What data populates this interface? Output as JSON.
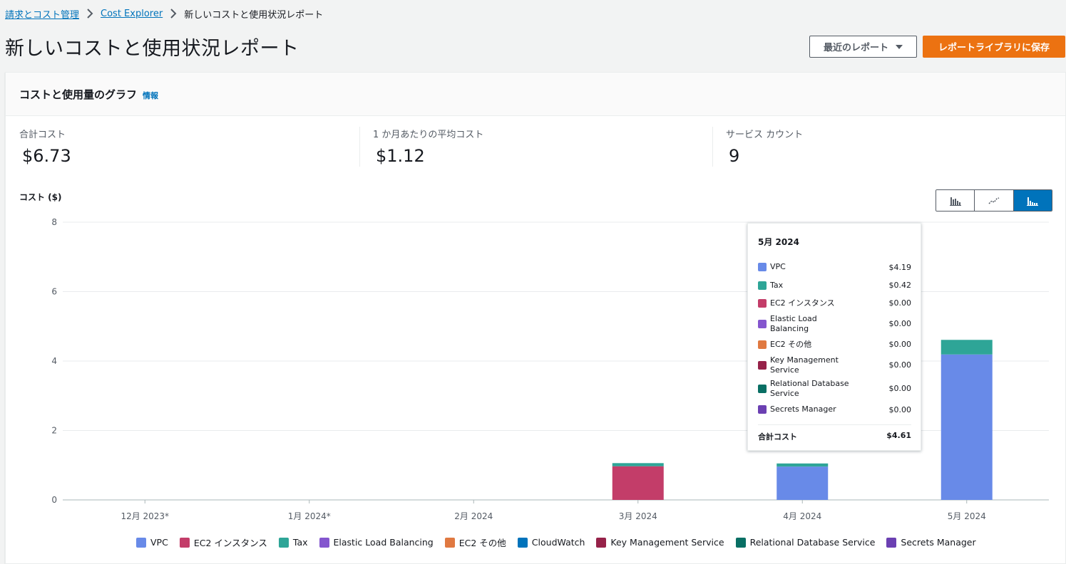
{
  "breadcrumb": {
    "items": [
      "請求とコスト管理",
      "Cost Explorer"
    ],
    "current": "新しいコストと使用状況レポート"
  },
  "header": {
    "title": "新しいコストと使用状況レポート",
    "recent_reports_label": "最近のレポート",
    "save_label": "レポートライブラリに保存"
  },
  "panel": {
    "title": "コストと使用量のグラフ",
    "info_label": "情報"
  },
  "metrics": [
    {
      "label": "合計コスト",
      "value": "$6.73"
    },
    {
      "label": "1 か月あたりの平均コスト",
      "value": "$1.12"
    },
    {
      "label": "サービス カウント",
      "value": "9"
    }
  ],
  "chart_controls": {
    "types": [
      "bar-grouped-icon",
      "line-icon",
      "bar-stacked-icon"
    ],
    "active": "bar-stacked-icon"
  },
  "tooltip": {
    "title": "5月 2024",
    "rows": [
      {
        "name": "VPC",
        "value": "$4.19",
        "color": "#688ae8"
      },
      {
        "name": "Tax",
        "value": "$0.42",
        "color": "#2ea597"
      },
      {
        "name": "EC2 インスタンス",
        "value": "$0.00",
        "color": "#c33d69"
      },
      {
        "name": "Elastic Load Balancing",
        "value": "$0.00",
        "color": "#8456ce"
      },
      {
        "name": "EC2 その他",
        "value": "$0.00",
        "color": "#e07941"
      },
      {
        "name": "Key Management Service",
        "value": "$0.00",
        "color": "#962249"
      },
      {
        "name": "Relational Database Service",
        "value": "$0.00",
        "color": "#096f64"
      },
      {
        "name": "Secrets Manager",
        "value": "$0.00",
        "color": "#6b40b2"
      }
    ],
    "total_label": "合計コスト",
    "total_value": "$4.61"
  },
  "chart_data": {
    "type": "bar",
    "stacked": true,
    "ylabel": "コスト ($)",
    "ylim": [
      0,
      8
    ],
    "yticks": [
      0,
      2,
      4,
      6,
      8
    ],
    "categories": [
      "12月 2023*",
      "1月 2024*",
      "2月 2024",
      "3月 2024",
      "4月 2024",
      "5月 2024"
    ],
    "series": [
      {
        "name": "VPC",
        "color": "#688ae8",
        "values": [
          0,
          0,
          0,
          0,
          0.96,
          4.19
        ]
      },
      {
        "name": "EC2 インスタンス",
        "color": "#c33d69",
        "values": [
          0,
          0,
          0,
          0.97,
          0,
          0
        ]
      },
      {
        "name": "Tax",
        "color": "#2ea597",
        "values": [
          0,
          0,
          0,
          0.09,
          0.09,
          0.42
        ]
      },
      {
        "name": "Elastic Load Balancing",
        "color": "#8456ce",
        "values": [
          0,
          0,
          0,
          0,
          0,
          0
        ]
      },
      {
        "name": "EC2 その他",
        "color": "#e07941",
        "values": [
          0,
          0,
          0,
          0,
          0,
          0
        ]
      },
      {
        "name": "CloudWatch",
        "color": "#0073bb",
        "values": [
          0,
          0,
          0,
          0,
          0,
          0
        ]
      },
      {
        "name": "Key Management Service",
        "color": "#962249",
        "values": [
          0,
          0,
          0,
          0,
          0,
          0
        ]
      },
      {
        "name": "Relational Database Service",
        "color": "#096f64",
        "values": [
          0,
          0,
          0,
          0,
          0,
          0
        ]
      },
      {
        "name": "Secrets Manager",
        "color": "#6b40b2",
        "values": [
          0,
          0,
          0,
          0,
          0,
          0
        ]
      }
    ],
    "grid": true,
    "legend_position": "bottom"
  }
}
